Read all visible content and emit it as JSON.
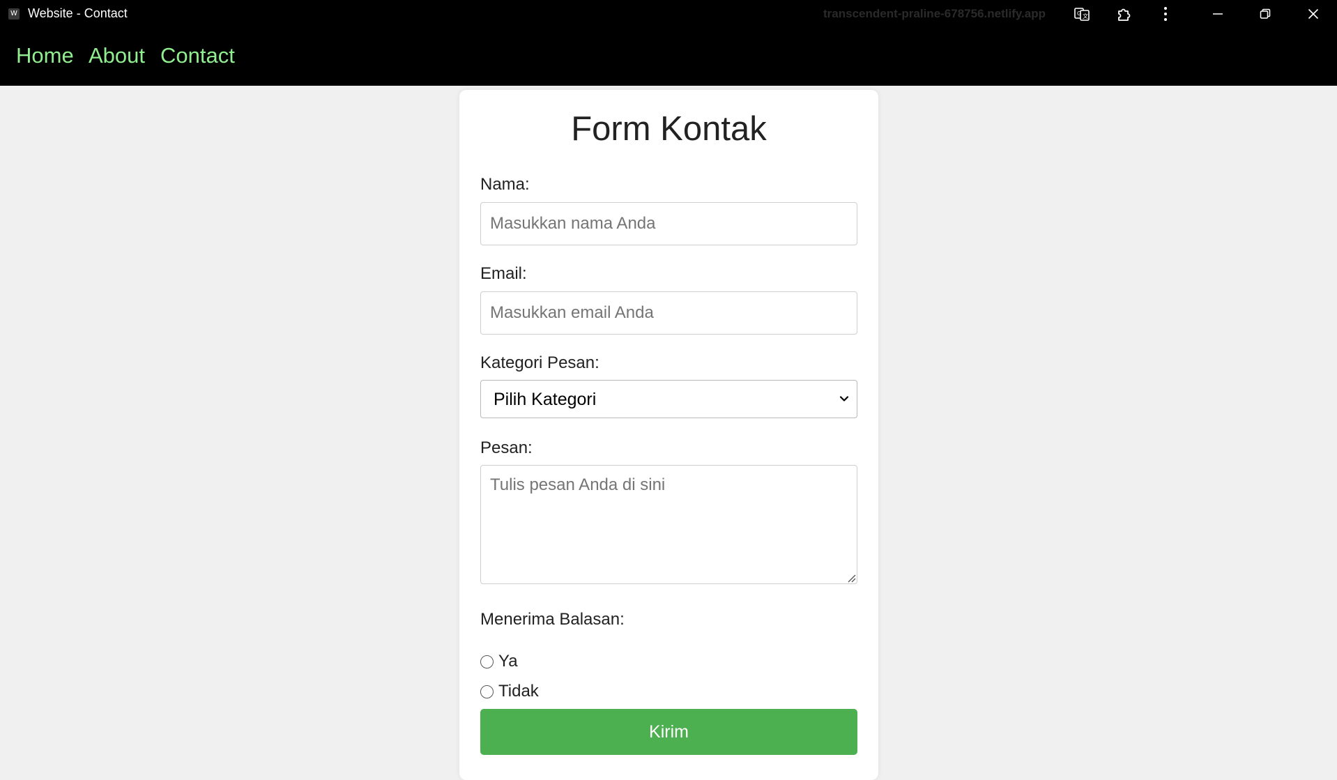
{
  "window": {
    "app_icon_letter": "W",
    "title": "Website - Contact",
    "url": "transcendent-praline-678756.netlify.app",
    "icons": [
      "translate-icon",
      "extensions-icon",
      "more-vert-icon",
      "minimize-icon",
      "restore-icon",
      "close-icon"
    ]
  },
  "nav": {
    "items": [
      {
        "label": "Home"
      },
      {
        "label": "About"
      },
      {
        "label": "Contact"
      }
    ],
    "link_color": "#90ee90"
  },
  "form": {
    "title": "Form Kontak",
    "name_label": "Nama:",
    "name_placeholder": "Masukkan nama Anda",
    "email_label": "Email:",
    "email_placeholder": "Masukkan email Anda",
    "category_label": "Kategori Pesan:",
    "category_selected": "Pilih Kategori",
    "message_label": "Pesan:",
    "message_placeholder": "Tulis pesan Anda di sini",
    "reply_label": "Menerima Balasan:",
    "reply_options": [
      {
        "label": "Ya",
        "checked": false
      },
      {
        "label": "Tidak",
        "checked": false
      }
    ],
    "submit_label": "Kirim",
    "submit_color": "#4caf50"
  }
}
